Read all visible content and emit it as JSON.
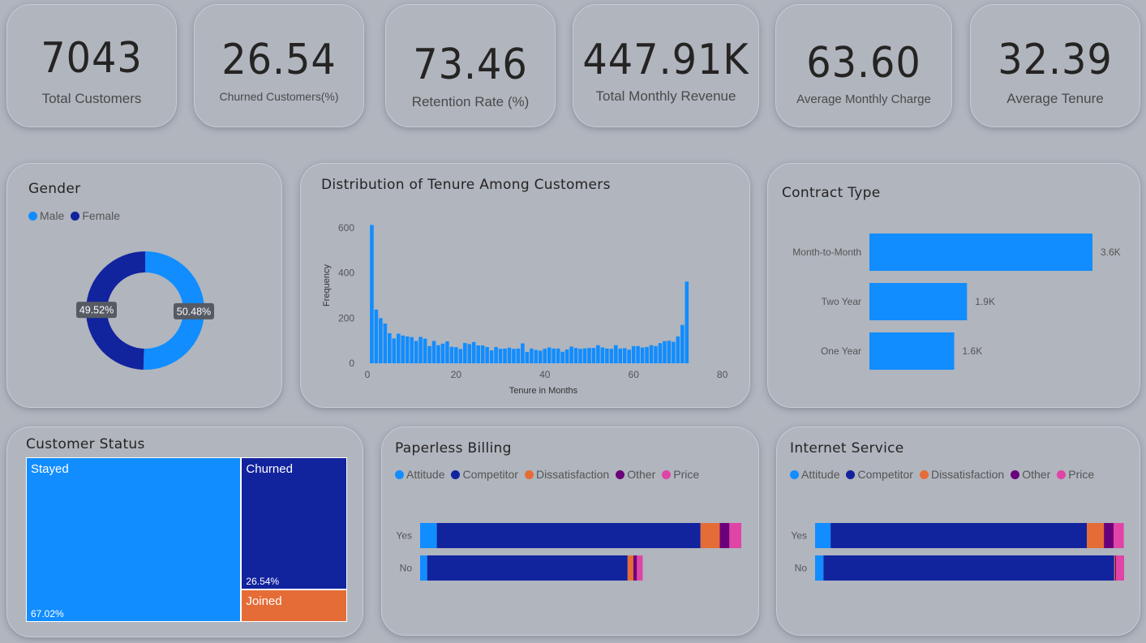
{
  "kpis": [
    {
      "value": "7043",
      "label": "Total Customers"
    },
    {
      "value": "26.54",
      "label": "Churned Customers(%)"
    },
    {
      "value": "73.46",
      "label": "Retention Rate (%)"
    },
    {
      "value": "447.91K",
      "label": "Total Monthly Revenue"
    },
    {
      "value": "63.60",
      "label": "Average Monthly Charge"
    },
    {
      "value": "32.39",
      "label": "Average Tenure"
    }
  ],
  "colors": {
    "light_blue": "#118dff",
    "dark_blue": "#12239e",
    "orange": "#e66c37",
    "purple": "#6b007b",
    "pink": "#e044a7",
    "background": "#b0b5be"
  },
  "chart_data": [
    {
      "type": "pie",
      "title": "Gender",
      "legend": [
        "Male",
        "Female"
      ],
      "slices": [
        {
          "name": "Male",
          "value": 50.48,
          "label": "50.48%",
          "color": "#118dff"
        },
        {
          "name": "Female",
          "value": 49.52,
          "label": "49.52%",
          "color": "#12239e"
        }
      ],
      "legend_position": "top-left"
    },
    {
      "type": "bar",
      "title": "Distribution of Tenure Among Customers",
      "xlabel": "Tenure in Months",
      "ylabel": "Frequency",
      "xlim": [
        0,
        80
      ],
      "ylim": [
        0,
        650
      ],
      "xticks": [
        0,
        20,
        40,
        60,
        80
      ],
      "yticks": [
        0,
        200,
        400,
        600
      ],
      "x": [
        1,
        2,
        3,
        4,
        5,
        6,
        7,
        8,
        9,
        10,
        11,
        12,
        13,
        14,
        15,
        16,
        17,
        18,
        19,
        20,
        21,
        22,
        23,
        24,
        25,
        26,
        27,
        28,
        29,
        30,
        31,
        32,
        33,
        34,
        35,
        36,
        37,
        38,
        39,
        40,
        41,
        42,
        43,
        44,
        45,
        46,
        47,
        48,
        49,
        50,
        51,
        52,
        53,
        54,
        55,
        56,
        57,
        58,
        59,
        60,
        61,
        62,
        63,
        64,
        65,
        66,
        67,
        68,
        69,
        70,
        71,
        72
      ],
      "values": [
        613,
        238,
        200,
        176,
        133,
        110,
        131,
        123,
        119,
        116,
        99,
        117,
        109,
        76,
        99,
        80,
        87,
        97,
        73,
        71,
        63,
        90,
        85,
        94,
        79,
        79,
        72,
        57,
        72,
        64,
        65,
        69,
        64,
        65,
        88,
        50,
        65,
        59,
        56,
        64,
        70,
        65,
        65,
        51,
        61,
        74,
        68,
        64,
        66,
        68,
        68,
        80,
        70,
        65,
        64,
        80,
        65,
        67,
        60,
        76,
        76,
        70,
        72,
        80,
        76,
        89,
        98,
        100,
        95,
        119,
        170,
        362
      ]
    },
    {
      "type": "bar",
      "orientation": "horizontal",
      "title": "Contract Type",
      "categories": [
        "Month-to-Month",
        "Two Year",
        "One Year"
      ],
      "values": [
        3875,
        1695,
        1473
      ],
      "data_labels": [
        "3.6K",
        "1.9K",
        "1.6K"
      ]
    },
    {
      "type": "treemap",
      "title": "Customer Status",
      "cells": [
        {
          "name": "Stayed",
          "value": 67.02,
          "label": "67.02%",
          "color": "#118dff"
        },
        {
          "name": "Churned",
          "value": 26.54,
          "label": "26.54%",
          "color": "#12239e"
        },
        {
          "name": "Joined",
          "value": 6.44,
          "color": "#e66c37"
        }
      ]
    },
    {
      "type": "bar",
      "orientation": "horizontal",
      "stacked": true,
      "title": "Paperless Billing",
      "categories": [
        "Yes",
        "No"
      ],
      "legend": [
        "Attitude",
        "Competitor",
        "Dissatisfaction",
        "Other",
        "Price"
      ],
      "series": [
        {
          "name": "Attitude",
          "color": "#118dff",
          "values": [
            5.2,
            2.2
          ]
        },
        {
          "name": "Competitor",
          "color": "#12239e",
          "values": [
            82.1,
            62.4
          ]
        },
        {
          "name": "Dissatisfaction",
          "color": "#e66c37",
          "values": [
            6.0,
            1.8
          ]
        },
        {
          "name": "Other",
          "color": "#6b007b",
          "values": [
            3.0,
            1.1
          ]
        },
        {
          "name": "Price",
          "color": "#e044a7",
          "values": [
            3.7,
            1.8
          ]
        }
      ]
    },
    {
      "type": "bar",
      "orientation": "horizontal",
      "stacked": true,
      "title": "Internet Service",
      "categories": [
        "Yes",
        "No"
      ],
      "legend": [
        "Attitude",
        "Competitor",
        "Dissatisfaction",
        "Other",
        "Price"
      ],
      "series": [
        {
          "name": "Attitude",
          "color": "#118dff",
          "values": [
            5.0,
            2.7
          ]
        },
        {
          "name": "Competitor",
          "color": "#12239e",
          "values": [
            82.6,
            93.7
          ]
        },
        {
          "name": "Dissatisfaction",
          "color": "#e66c37",
          "values": [
            5.5,
            0.3
          ]
        },
        {
          "name": "Other",
          "color": "#6b007b",
          "values": [
            3.1,
            0.3
          ]
        },
        {
          "name": "Price",
          "color": "#e044a7",
          "values": [
            3.3,
            2.6
          ]
        }
      ]
    }
  ]
}
